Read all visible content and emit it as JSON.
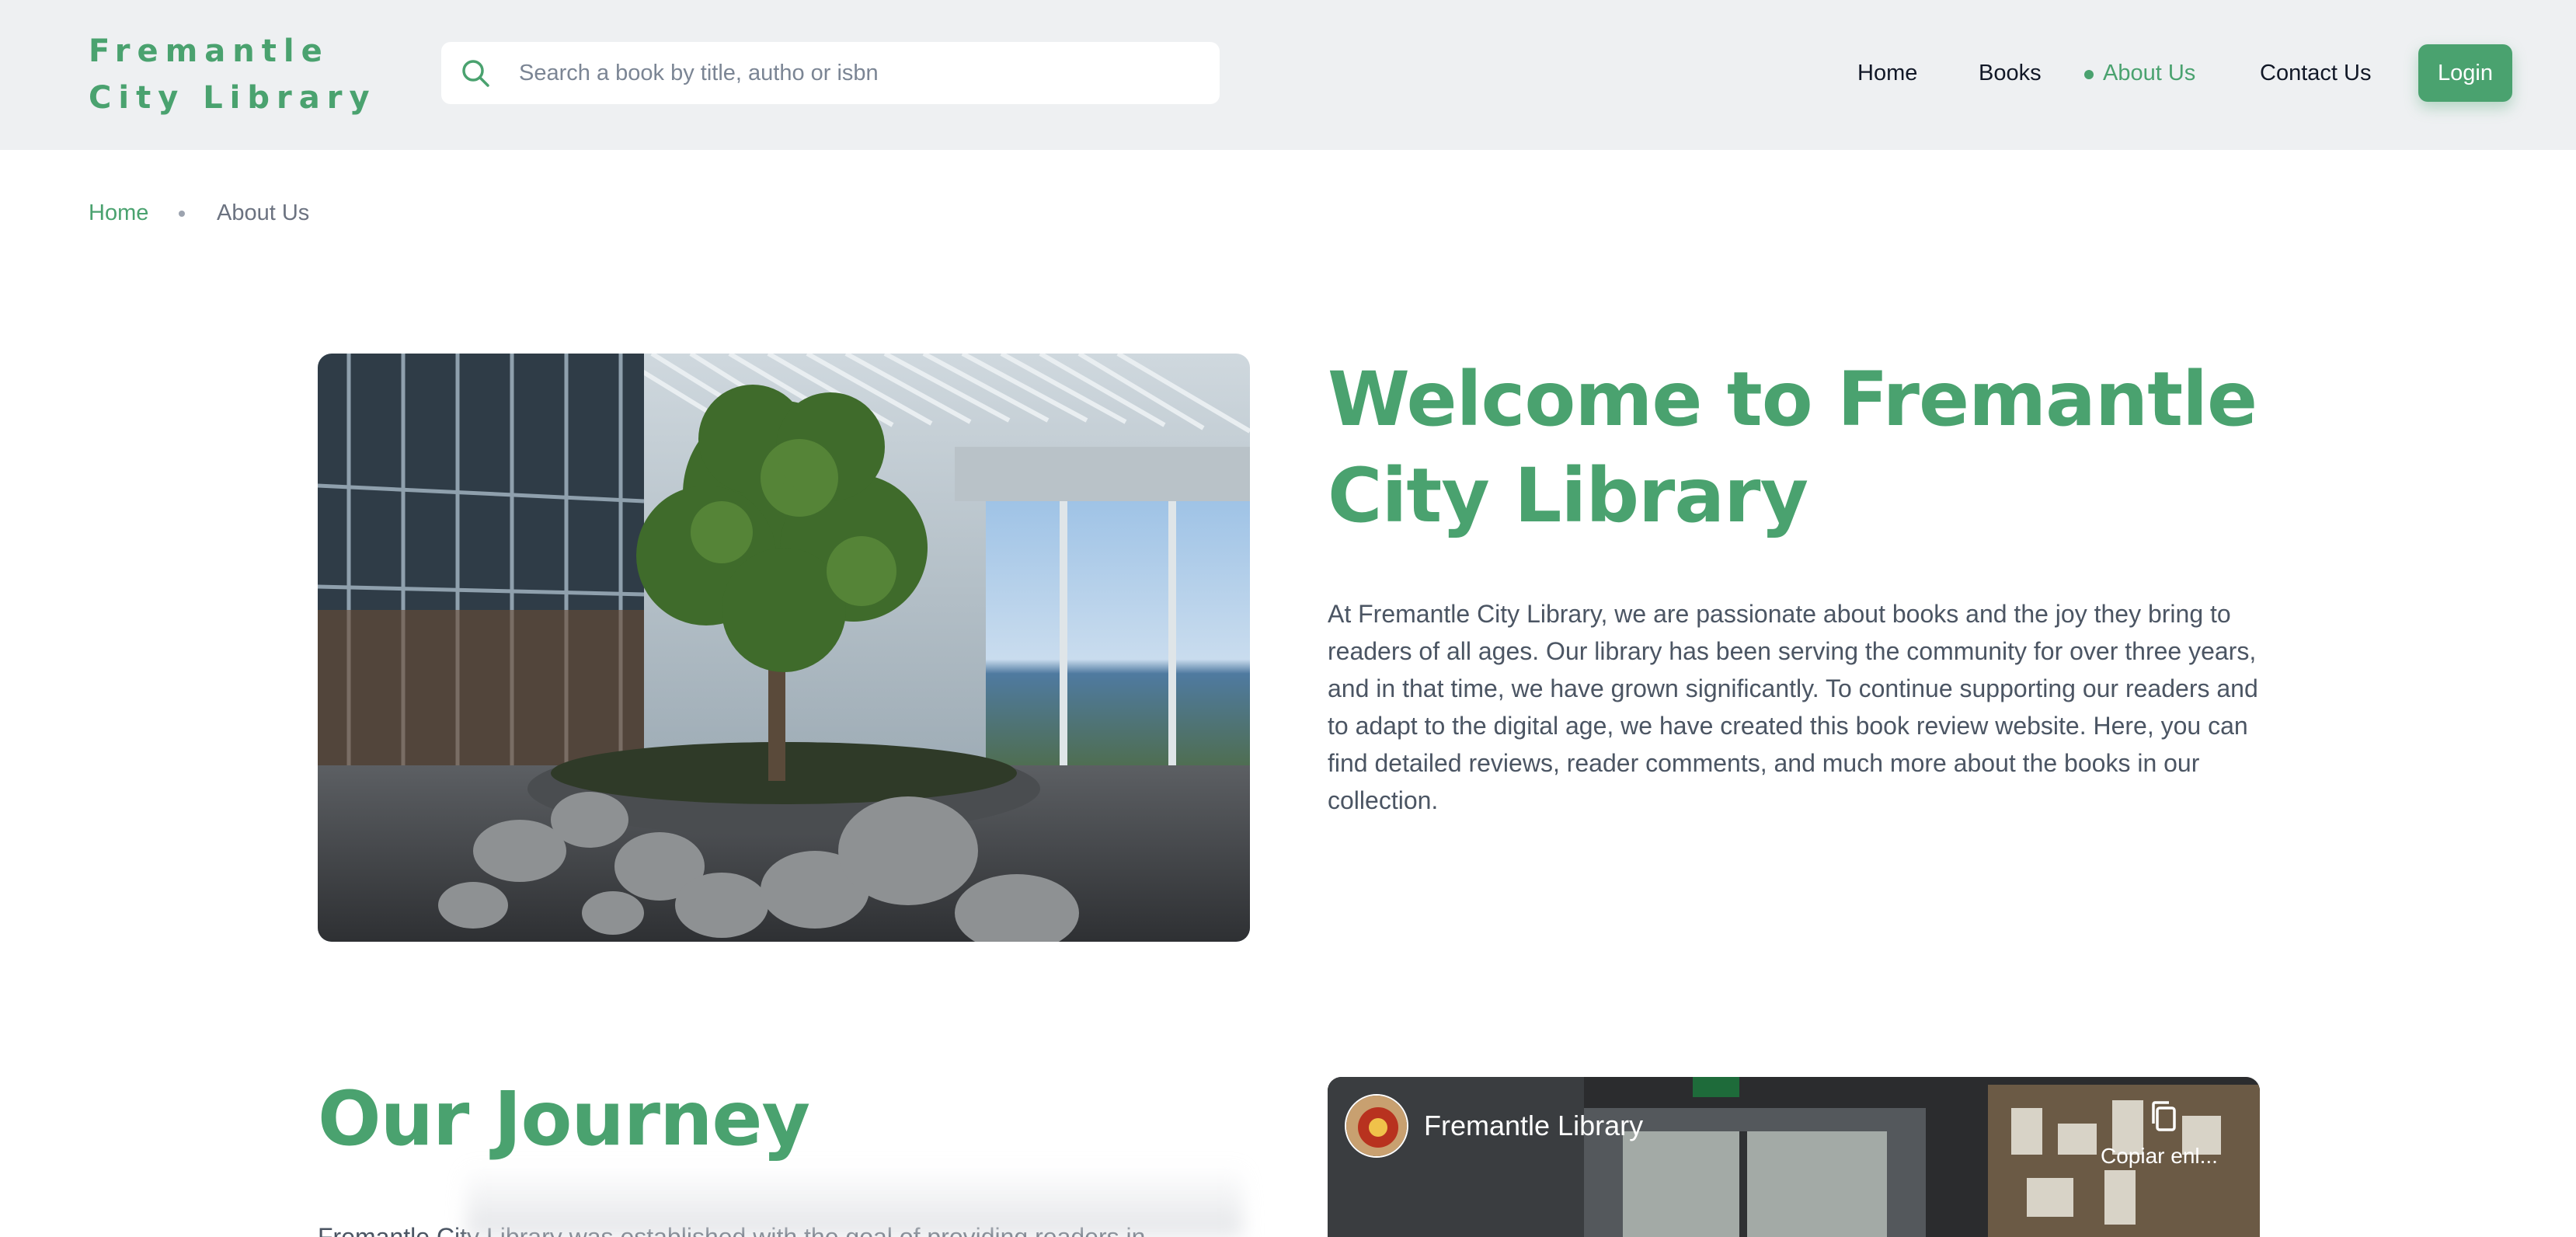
{
  "header": {
    "logo": "Fremantle City Library",
    "search": {
      "placeholder": "Search a book by title, autho or isbn",
      "value": ""
    },
    "nav": [
      {
        "label": "Home",
        "active": false
      },
      {
        "label": "Books",
        "active": false
      },
      {
        "label": "About Us",
        "active": true
      },
      {
        "label": "Contact Us",
        "active": false
      }
    ],
    "login_label": "Login"
  },
  "breadcrumb": {
    "home": "Home",
    "current": "About Us"
  },
  "hero": {
    "title": "Welcome to Fremantle City Library",
    "text": "At Fremantle City Library, we are passionate about books and the joy they bring to readers of all ages. Our library has been serving the community for over three years, and in that time, we have grown significantly. To continue supporting our readers and to adapt to the digital age, we have created this book review website. Here, you can find detailed reviews, reader comments, and much more about the books in our collection."
  },
  "journey": {
    "title": "Our Journey",
    "text": "Fremantle City Library was established with the goal of providing readers in"
  },
  "video": {
    "title": "Fremantle Library",
    "copy_label": "Copiar enl..."
  },
  "colors": {
    "accent": "#4aa26f",
    "header_bg": "#eef0f2",
    "body_text": "#4b5563"
  },
  "icons": {
    "search": "search-icon",
    "copy": "copy-link-icon"
  }
}
